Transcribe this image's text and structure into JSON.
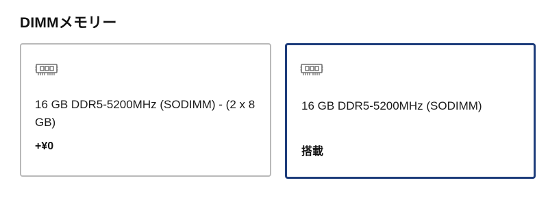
{
  "section": {
    "title": "DIMMメモリー"
  },
  "options": [
    {
      "icon": "memory-module-icon",
      "label": "16 GB DDR5-5200MHz (SODIMM) - (2 x 8 GB)",
      "price": "+¥0",
      "selected": false
    },
    {
      "icon": "memory-module-icon",
      "label": "16 GB DDR5-5200MHz (SODIMM)",
      "price": "搭載",
      "selected": true
    }
  ],
  "colors": {
    "selected_border": "#1e3d7b",
    "unselected_border": "#b9b9b9",
    "icon_stroke": "#6f6f6f"
  }
}
